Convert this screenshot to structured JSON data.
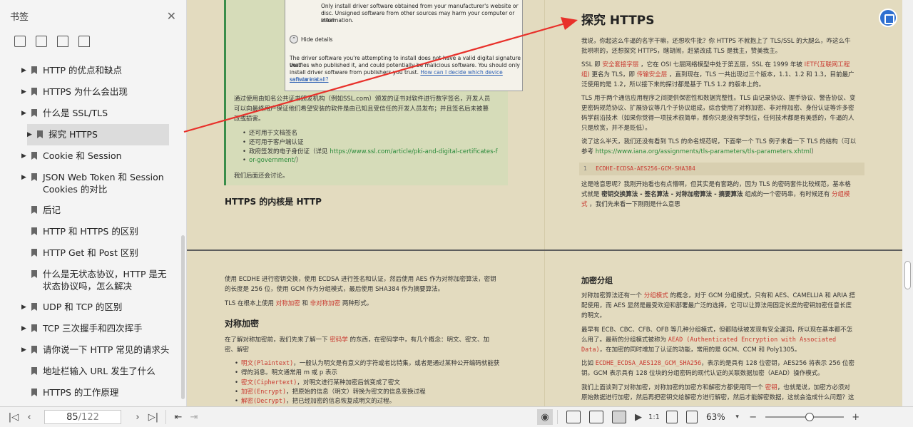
{
  "sidebar": {
    "title": "书签",
    "items": [
      {
        "label": "HTTP 的优点和缺点",
        "has_children": true
      },
      {
        "label": "HTTPS 为什么会出现",
        "has_children": true
      },
      {
        "label": "什么是 SSL/TLS",
        "has_children": true
      },
      {
        "label": "探究 HTTPS",
        "has_children": true,
        "active": true
      },
      {
        "label": "Cookie 和 Session",
        "has_children": true
      },
      {
        "label": "JSON Web Token 和 Session Cookies 的对比",
        "has_children": true
      },
      {
        "label": "后记",
        "has_children": false
      },
      {
        "label": "HTTP 和 HTTPS 的区别",
        "has_children": false
      },
      {
        "label": "HTTP Get 和 Post 区别",
        "has_children": false
      },
      {
        "label": "什么是无状态协议，HTTP 是无状态协议吗，怎么解决",
        "has_children": false
      },
      {
        "label": "UDP 和 TCP 的区别",
        "has_children": true
      },
      {
        "label": "TCP 三次握手和四次挥手",
        "has_children": true
      },
      {
        "label": "请你说一下 HTTP 常见的请求头",
        "has_children": true
      },
      {
        "label": "地址栏输入 URL 发生了什么",
        "has_children": false
      },
      {
        "label": "HTTPS 的工作原理",
        "has_children": false
      }
    ]
  },
  "page1": {
    "dialog": {
      "line1": "Only install driver software obtained from your manufacturer's website or",
      "line2": "disc. Unsigned software from other sources may harm your computer or steal",
      "line3": "information.",
      "hide_details": "Hide details",
      "body1": "The driver software you're attempting to install does not have a valid digital signature that",
      "body2": "verifies who published it, and could potentially be malicious software. You should only",
      "body3": "install driver software from publishers you trust.",
      "body_link": "How can I decide which device software is",
      "body4": "safe to install?"
    },
    "left_para1": "通过使用由知名公共证书颁发机构（例如SSL.com）颁发的证书对软件进行数字签名，开发人员",
    "left_para2": "可以向最终用户保证他们希望安装的软件是由已知且受信任的开发人员发布；并且签名后未被篡",
    "left_para3": "改或损害。",
    "bullets": [
      "还可用于文档签名",
      "还可用于客户端认证",
      "政府签发的电子身份证（详见"
    ],
    "bullet_link1": "https://www.ssl.com/article/pki-and-digital-certificates-f",
    "bullet_link2": "or-government/",
    "bullet_link_end": "）",
    "left_end": "我们后面还会讨论。",
    "left_heading": "HTTPS 的内核是 HTTP",
    "right_title": "探究 HTTPS",
    "r1a": "我说，你起这么牛逼的名字干嘛，还想吹牛批？你 HTTPS 不就抱上了 TLS/SSL 的大腿么，咋这么牛",
    "r1b": "批哄哄的，还想探究 HTTPS，瞎胡闹，赶紧改成 TLS 是我主，赞美我主。",
    "r2a_pre": "SSL 即",
    "r2a_hl": "安全套接字层",
    "r2a_mid": "，它在 OSI 七层网络模型中处于第五层，SSL 在 1999 年被",
    "r2a_hl2": "IETF(互联网工程",
    "r2b_hl": "组)",
    "r2b_mid": "更名为 TLS，即",
    "r2b_hl2": "传输安全层",
    "r2b_end": "，直到现在，TLS 一共出现过三个版本，1.1、1.2 和 1.3，目前最广",
    "r2c": "泛使用的是 1.2，所以接下来的探讨都是基于 TLS 1.2 的版本上的。",
    "r3a": "TLS 用于两个通信应用程序之间提供保密性和数据完整性。TLS 由记录协议、握手协议、警告协议、变",
    "r3b": "更密码规范协议、扩展协议等几个子协议组成，综合使用了对称加密、非对称加密、身份认证等许多密",
    "r3c": "码学前沿技术（如果你觉得一项技术很简单，那你只是没有学到位，任何技术都是有美感的，牛逼的人",
    "r3d": "只是欣赏，并不是贬低）。",
    "r4a": "说了这么半天，我们还没有看到 TLS 的命名规范呢，下面举一个 TLS 例子来看一下 TLS 的结构（可以",
    "r4b_pre": "参考",
    "r4b_link": "https://www.iana.org/assignments/tls-parameters/tls-parameters.xhtml",
    "r4b_end": "）",
    "code_line_no": "1",
    "code_text": "ECDHE-ECDSA-AES256-GCM-SHA384",
    "r5a": "这是啥意思呢？我刚开始看也有点懵啊，但其实是有套路的，因为 TLS 的密码套件比较规范，基本格",
    "r5b_pre": "式就是",
    "r5b_bold": "密钥交换算法 - 签名算法 - 对称加密算法 - 摘要算法",
    "r5b_mid": "组成的一个密码串，有时候还有",
    "r5b_hl": "分组模",
    "r5c_hl": "式",
    "r5c_end": "，我们先来看一下刚刚是什么意思"
  },
  "page2": {
    "l1a": "使用 ECDHE 进行密钥交换，使用 ECDSA 进行签名和认证，然后使用 AES 作为对称加密算法，密钥",
    "l1b": "的长度是 256 位，使用 GCM 作为分组模式，最后使用 SHA384 作为摘要算法。",
    "l2_pre": "TLS 在根本上使用",
    "l2_hl1": "对称加密",
    "l2_mid": "和",
    "l2_hl2": "非对称加密",
    "l2_end": "两种形式。",
    "heading": "对称加密",
    "l3a_pre": "在了解对称加密前，我们先来了解一下",
    "l3a_hl": "密码学",
    "l3a_end": "的东西，在密码学中，有几个概念：明文、密文、加",
    "l3b": "密、解密",
    "b1_hl": "明文(Plaintext)",
    "b1a": "，一般认为明文是有意义的字符或者比特集，或者是通过某种公开编码就能获",
    "b1b": "得的消息。明文通常用 m 或 p 表示",
    "b2_hl": "密文(Ciphertext)",
    "b2": "，对明文进行某种加密后就变成了密文",
    "b3_hl": "加密(Encrypt)",
    "b3": "，把原始的信息（明文）转换为密文的信息变换过程",
    "b4_hl": "解密(Decrypt)",
    "b4": "，把已经加密的信息恢复成明文的过程。",
    "r_heading": "加密分组",
    "r1a_pre": "对称加密算法还有一个",
    "r1a_hl": "分组模式",
    "r1a_end": "的概念，对于 GCM 分组模式，只有和 AES、CAMELLIA 和 ARIA 搭",
    "r1b": "配使用，而 AES 显然是最受欢迎和部署最广泛的选择，它可以让算法用固定长度的密钥加密任意长度",
    "r1c": "的明文。",
    "r2a": "最早有 ECB、CBC、CFB、OFB 等几种分组模式，但都陆续被发现有安全漏洞，所以现在基本都不怎",
    "r2b_pre": "么用了。最新的分组模式被称为",
    "r2b_hl": "AEAD (Authenticated Encryption with Associated",
    "r2c_hl": "Data)",
    "r2c_end": "，在加密的同时增加了认证的功能，常用的是 GCM、CCM 和 Poly1305。",
    "r3a_pre": "比如",
    "r3a_hl": "ECDHE_ECDSA_AES128_GCM_SHA256",
    "r3a_end": "，表示的是具有 128 位密钥，AES256 将表示 256 位密",
    "r3b": "钥。GCM 表示具有 128 位块的分组密码的现代认证的关联数据加密（AEAD）操作模式。",
    "r4a_pre": "我们上面谈到了对称加密，对称加密的加密方和解密方都使用同一个",
    "r4a_hl": "密钥",
    "r4a_end": "，也就是说，加密方必须对",
    "r4b": "原始数据进行加密，然后再把密钥交给解密方进行解密，然后才能解密数据，这就会造成什么问题？这"
  },
  "toolbar": {
    "current_page": "85",
    "total_pages": "/122",
    "zoom": "63%"
  },
  "colors": {
    "page_bg": "#e3dbbf",
    "highlight": "#c8382f",
    "link": "#2a8a3a",
    "arrow": "#e8302a"
  }
}
